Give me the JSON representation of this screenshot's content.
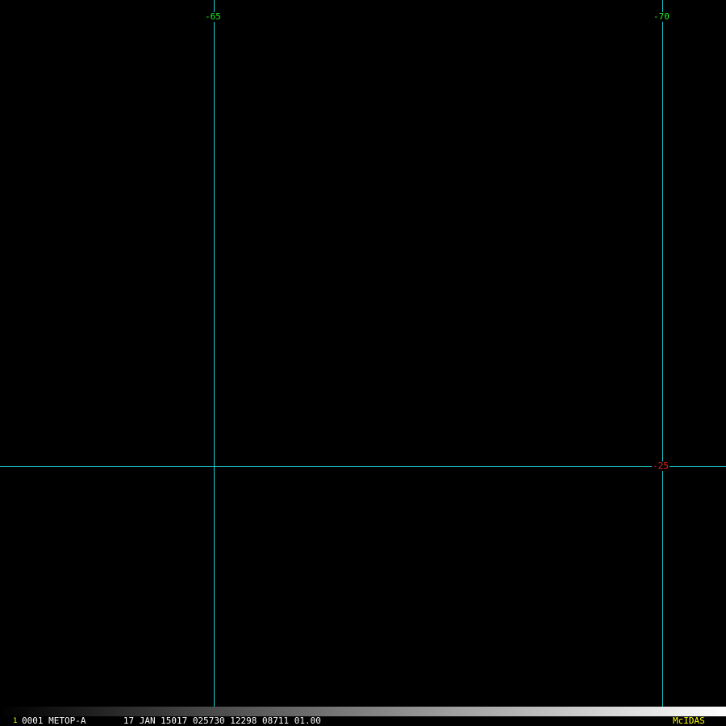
{
  "map": {
    "grid_color": "#1fd2d2",
    "longitude_lines": [
      {
        "label": "-65",
        "color": "#22ee22"
      },
      {
        "label": "-70",
        "color": "#22ee22"
      }
    ],
    "latitude_lines": [
      {
        "label": "-25",
        "color": "#ee2222"
      }
    ]
  },
  "status_bar": {
    "frame_number": "1",
    "frame_number_color": "#ffff00",
    "header": "0001 METOP-A       17 JAN 15017 025730 12298 08711 01.00",
    "system_label": "McIDAS",
    "system_label_color": "#ffff00",
    "gray_ramp": [
      "#000000",
      "#ffffff"
    ]
  }
}
